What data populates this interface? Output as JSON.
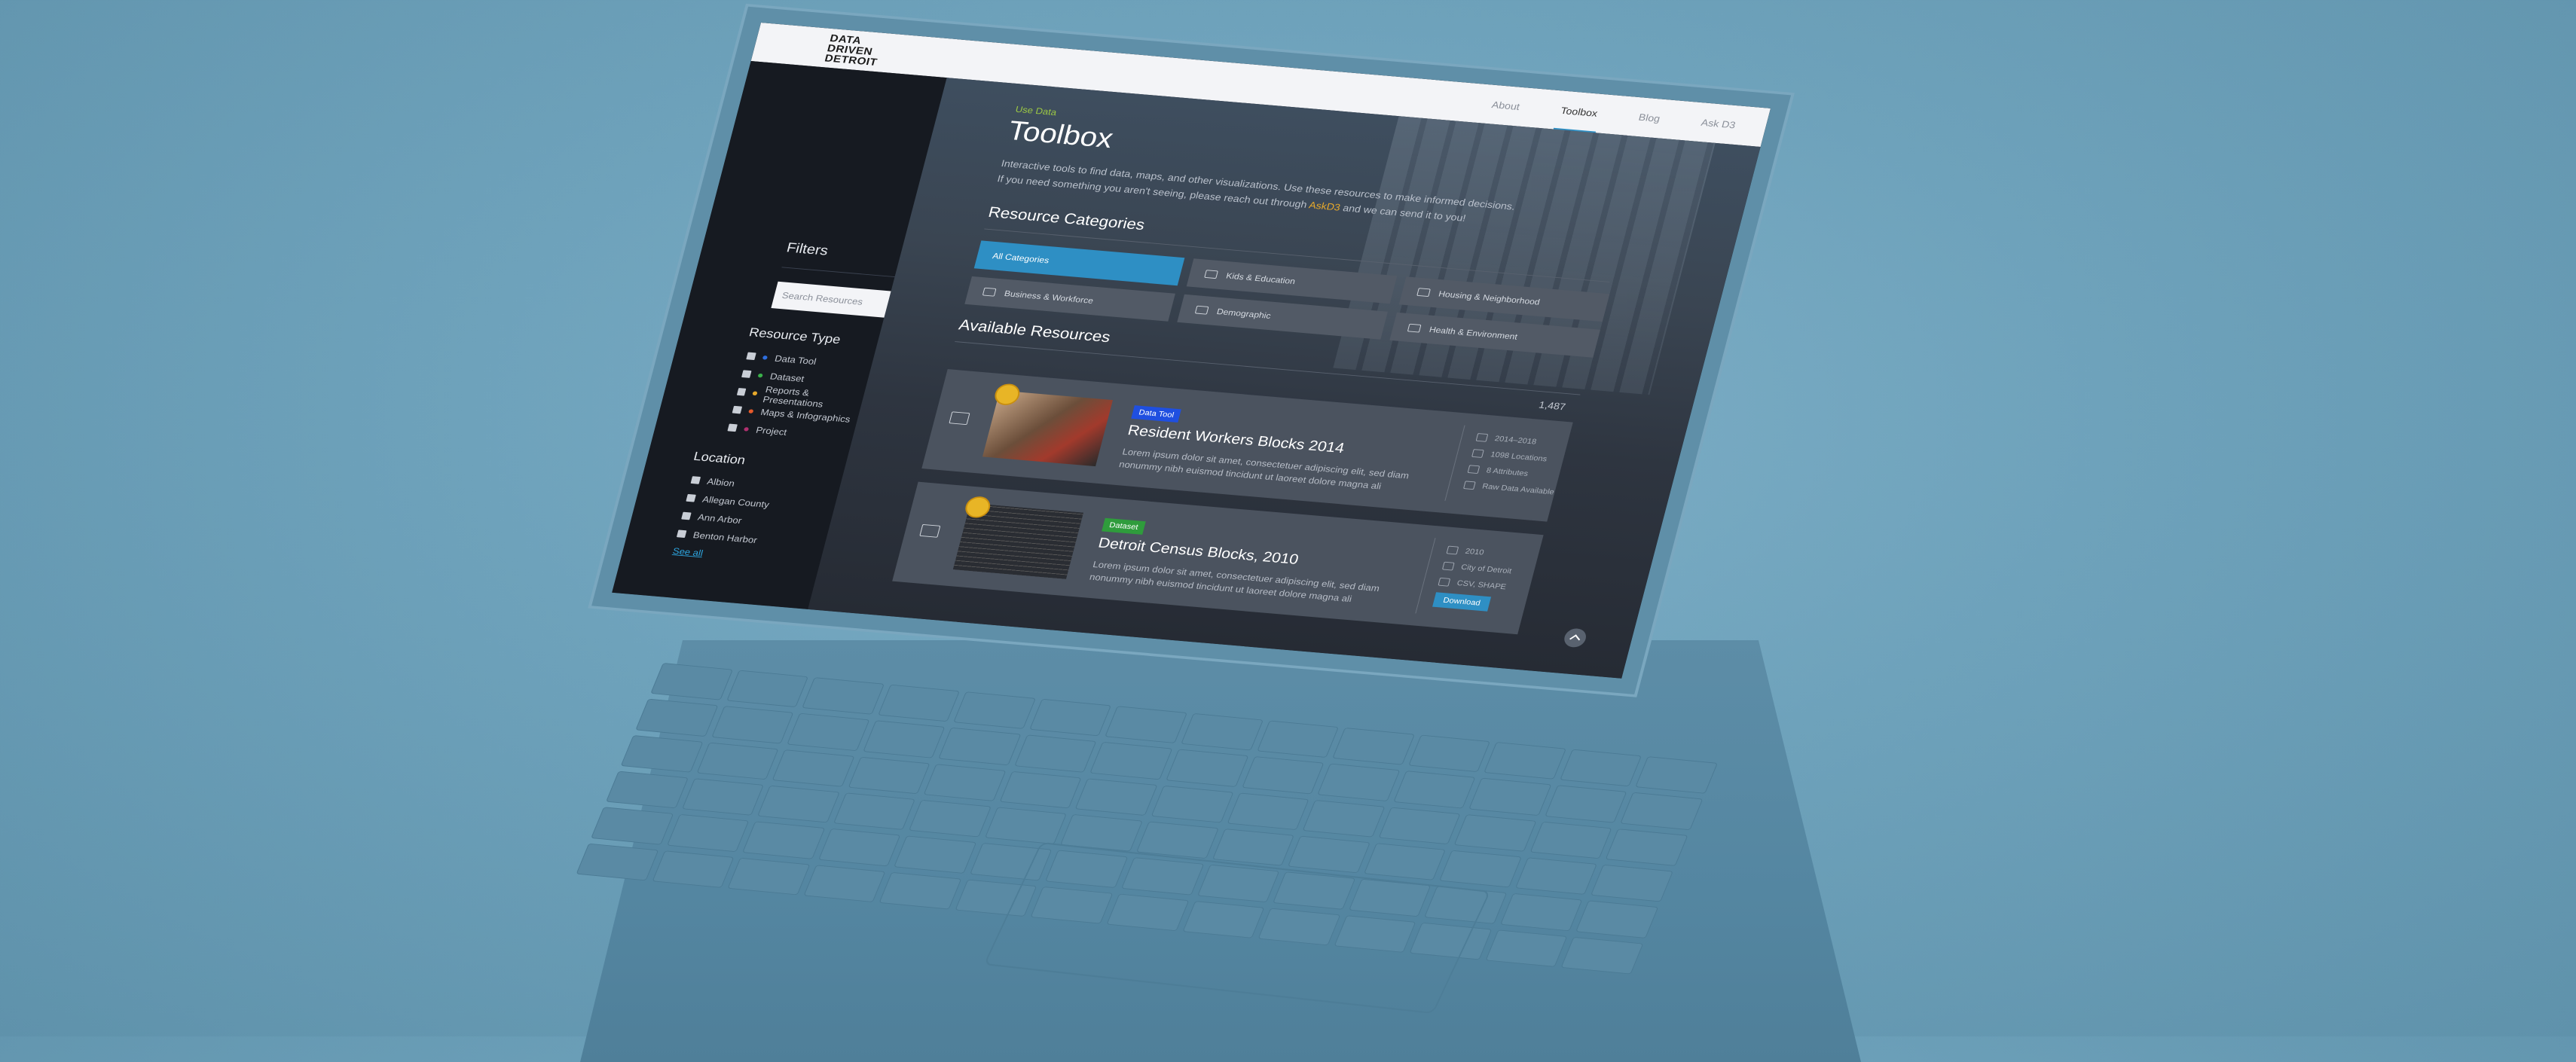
{
  "header": {
    "logo_line1": "DATA",
    "logo_line2": "DRIVEN",
    "logo_line3": "DETROIT",
    "nav": [
      "About",
      "Toolbox",
      "Blog",
      "Ask D3"
    ],
    "active_nav": "Toolbox"
  },
  "sidebar": {
    "filters_title": "Filters",
    "search_placeholder": "Search Resources",
    "resource_type_title": "Resource Type",
    "resource_types": [
      {
        "label": "Data Tool",
        "color": "#2e6fe0"
      },
      {
        "label": "Dataset",
        "color": "#3ab04a"
      },
      {
        "label": "Reports & Presentations",
        "color": "#e6a82b"
      },
      {
        "label": "Maps & Infographics",
        "color": "#e65a2b"
      },
      {
        "label": "Project",
        "color": "#b0306f"
      }
    ],
    "location_title": "Location",
    "locations": [
      "Albion",
      "Allegan County",
      "Ann Arbor",
      "Benton Harbor"
    ],
    "see_all": "See all"
  },
  "main": {
    "eyebrow": "Use Data",
    "title": "Toolbox",
    "intro_line1": "Interactive tools to find data, maps, and other visualizations. Use these resources to make informed decisions.",
    "intro_line2_pre": "If you need something you aren't seeing, please reach out through ",
    "intro_link": "AskD3",
    "intro_line2_post": " and we can send it to you!",
    "categories_title": "Resource Categories",
    "categories": [
      "All Categories",
      "Kids & Education",
      "Housing & Neighborhood",
      "Business & Workforce",
      "Demographic",
      "Health & Environment"
    ],
    "active_category": "All Categories",
    "available_title": "Available Resources",
    "count": "1,487",
    "cards": [
      {
        "badge": "Data Tool",
        "badge_color": "#1f4fe0",
        "title": "Resident Workers Blocks 2014",
        "desc": "Lorem ipsum dolor sit amet, consectetuer adipiscing elit, sed diam nonummy nibh euismod tincidunt ut laoreet dolore magna ali",
        "meta": [
          "2014–2018",
          "1098 Locations",
          "8 Attributes",
          "Raw Data Available"
        ]
      },
      {
        "badge": "Dataset",
        "badge_color": "#2f9c3c",
        "title": "Detroit Census Blocks, 2010",
        "desc": "Lorem ipsum dolor sit amet, consectetuer adipiscing elit, sed diam nonummy nibh euismod tincidunt ut laoreet dolore magna ali",
        "meta": [
          "2010",
          "City of Detroit",
          "CSV, SHAPE"
        ],
        "download": "Download"
      }
    ]
  }
}
